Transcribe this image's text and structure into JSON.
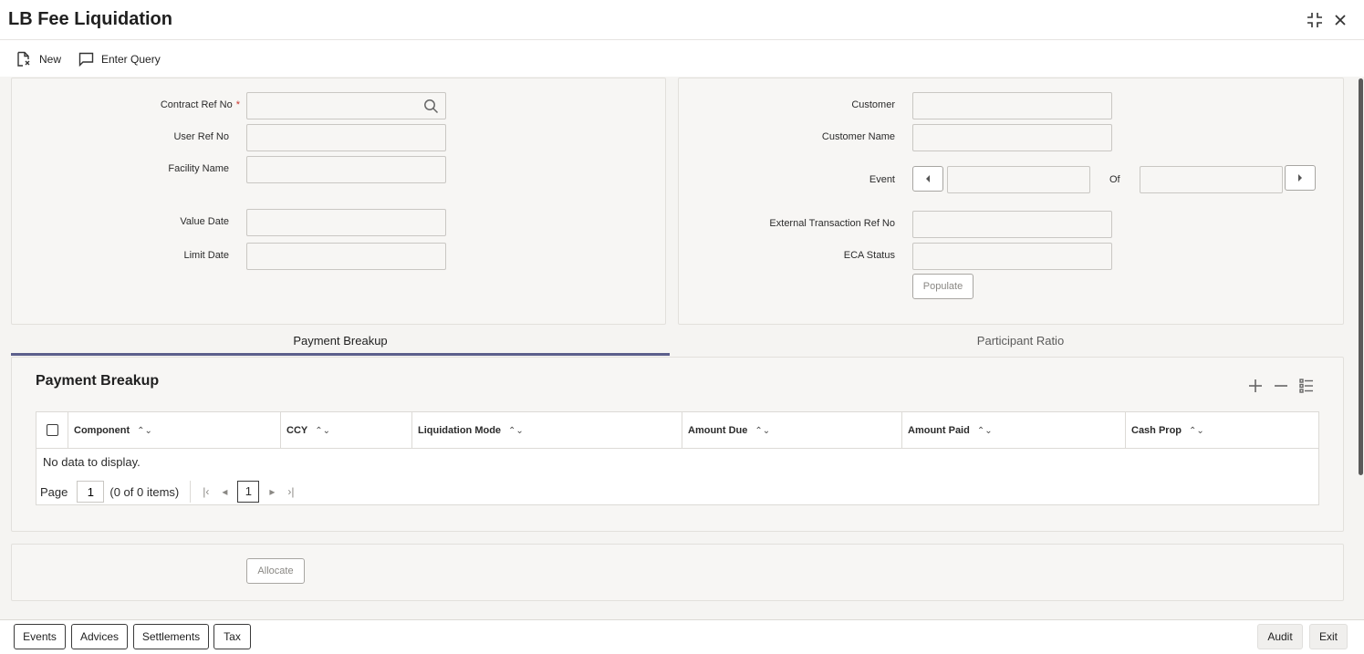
{
  "window": {
    "title": "LB Fee Liquidation",
    "icons": {
      "maximize": "collapse-icon",
      "close": "close-icon"
    }
  },
  "toolbar": {
    "new_label": "New",
    "enter_query_label": "Enter Query"
  },
  "left_panel": {
    "contract_ref_label": "Contract Ref No",
    "contract_ref_required": "*",
    "contract_ref_value": "",
    "user_ref_label": "User Ref No",
    "user_ref_value": "",
    "facility_name_label": "Facility Name",
    "facility_name_value": "",
    "value_date_label": "Value Date",
    "value_date_value": "",
    "limit_date_label": "Limit Date",
    "limit_date_value": ""
  },
  "right_panel": {
    "customer_label": "Customer",
    "customer_value": "",
    "customer_name_label": "Customer Name",
    "customer_name_value": "",
    "event_label": "Event",
    "event_value": "",
    "of_label": "Of",
    "of_value": "",
    "ext_txn_ref_label": "External Transaction Ref No",
    "ext_txn_ref_value": "",
    "eca_status_label": "ECA Status",
    "eca_status_value": "",
    "populate_label": "Populate"
  },
  "tabs": [
    {
      "label": "Payment Breakup",
      "active": true
    },
    {
      "label": "Participant Ratio",
      "active": false
    }
  ],
  "payment_breakup": {
    "title": "Payment Breakup",
    "columns": [
      "Component",
      "CCY",
      "Liquidation Mode",
      "Amount Due",
      "Amount Paid",
      "Cash Prop"
    ],
    "no_data_text": "No data to display.",
    "pager": {
      "page_label": "Page",
      "page_value": "1",
      "items_text": "(0 of 0 items)",
      "current_page": "1"
    }
  },
  "allocate_label": "Allocate",
  "footer": {
    "buttons": [
      "Events",
      "Advices",
      "Settlements",
      "Tax"
    ],
    "audit_label": "Audit",
    "exit_label": "Exit"
  },
  "colors": {
    "accent_tab_underline": "#5c5f8c",
    "required": "#c9362e"
  }
}
